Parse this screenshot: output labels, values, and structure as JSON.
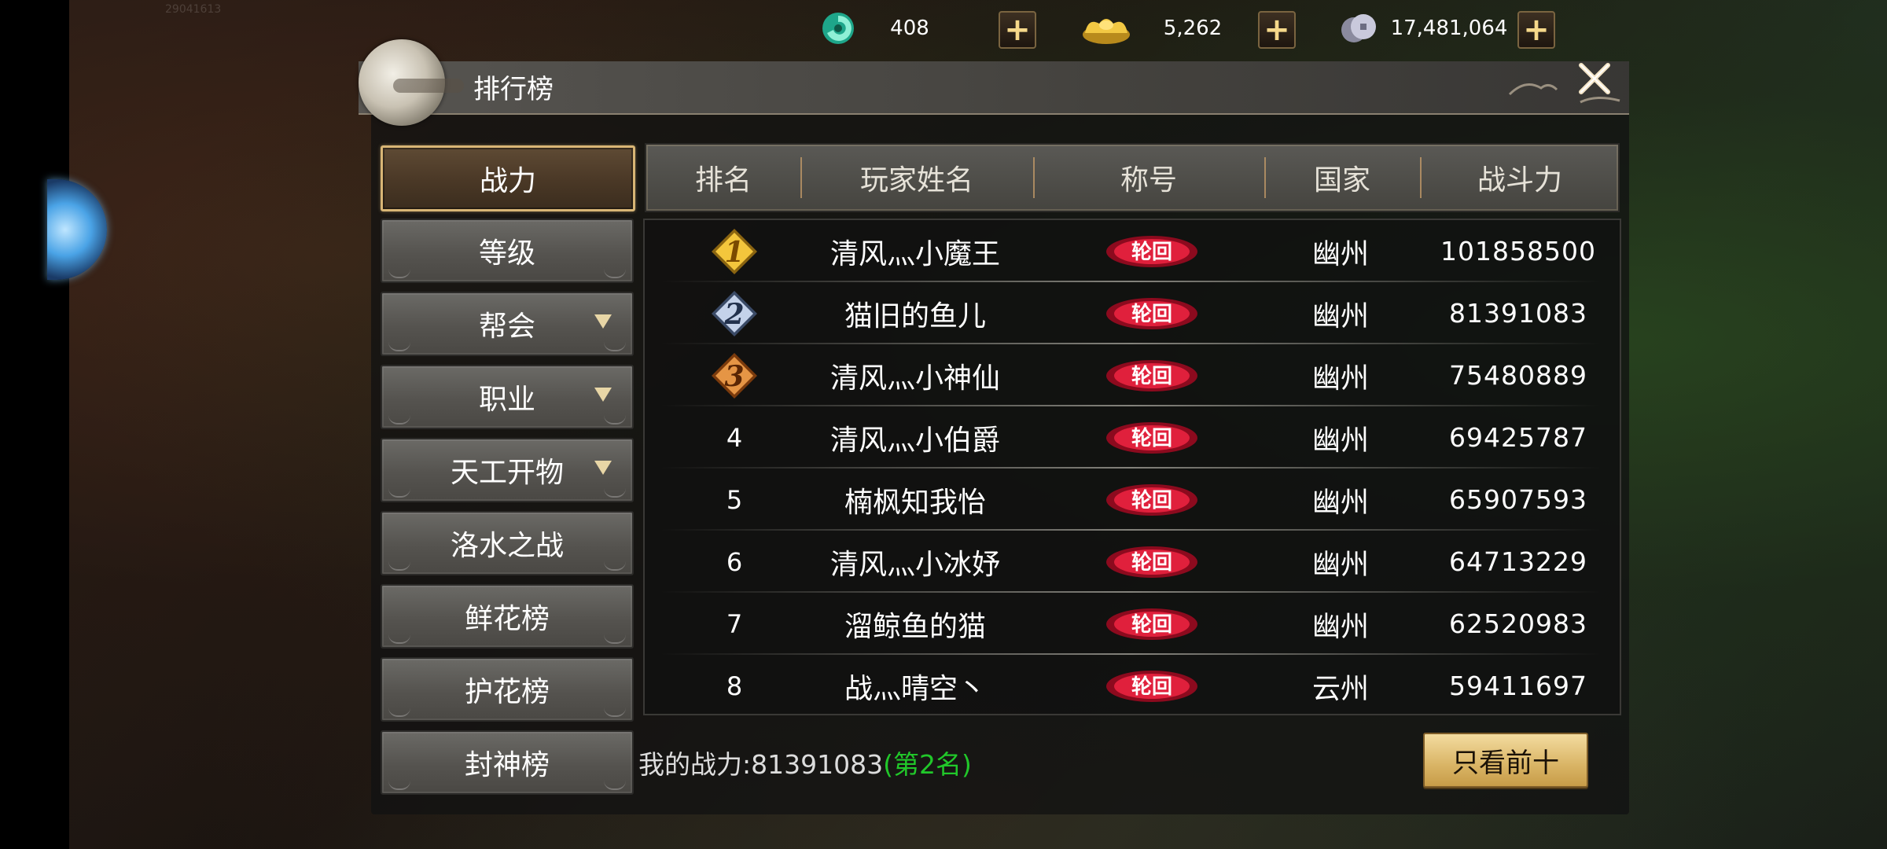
{
  "currencies": [
    {
      "icon": "jade-icon",
      "value": "408"
    },
    {
      "icon": "gold-ingot-icon",
      "value": "5,262"
    },
    {
      "icon": "silver-coin-icon",
      "value": "17,481,064"
    }
  ],
  "watermark_id": "29041613",
  "panel": {
    "title": "排行榜",
    "close_icon": "close-icon"
  },
  "categories": [
    {
      "label": "战力",
      "active": true,
      "has_arrow": false
    },
    {
      "label": "等级",
      "active": false,
      "has_arrow": false
    },
    {
      "label": "帮会",
      "active": false,
      "has_arrow": true
    },
    {
      "label": "职业",
      "active": false,
      "has_arrow": true
    },
    {
      "label": "天工开物",
      "active": false,
      "has_arrow": true
    },
    {
      "label": "洛水之战",
      "active": false,
      "has_arrow": false
    },
    {
      "label": "鲜花榜",
      "active": false,
      "has_arrow": false
    },
    {
      "label": "护花榜",
      "active": false,
      "has_arrow": false
    },
    {
      "label": "封神榜",
      "active": false,
      "has_arrow": false
    }
  ],
  "table": {
    "headers": [
      "排名",
      "玩家姓名",
      "称号",
      "国家",
      "战斗力"
    ],
    "rows": [
      {
        "rank": "1",
        "name": "清风灬小魔王",
        "title": "轮回",
        "country": "幽州",
        "power": "101858500"
      },
      {
        "rank": "2",
        "name": "猫旧的鱼儿",
        "title": "轮回",
        "country": "幽州",
        "power": "81391083"
      },
      {
        "rank": "3",
        "name": "清风灬小神仙",
        "title": "轮回",
        "country": "幽州",
        "power": "75480889"
      },
      {
        "rank": "4",
        "name": "清风灬小伯爵",
        "title": "轮回",
        "country": "幽州",
        "power": "69425787"
      },
      {
        "rank": "5",
        "name": "楠枫知我怡",
        "title": "轮回",
        "country": "幽州",
        "power": "65907593"
      },
      {
        "rank": "6",
        "name": "清风灬小冰妤",
        "title": "轮回",
        "country": "幽州",
        "power": "64713229"
      },
      {
        "rank": "7",
        "name": "溜鲸鱼的猫",
        "title": "轮回",
        "country": "幽州",
        "power": "62520983"
      },
      {
        "rank": "8",
        "name": "战灬晴空丶",
        "title": "轮回",
        "country": "云州",
        "power": "59411697"
      }
    ]
  },
  "footer": {
    "my_power_label": "我的战力:81391083",
    "my_rank": "(第2名)",
    "top10_button": "只看前十"
  },
  "colors": {
    "accent_gold": "#d9b465",
    "rank_green": "#21c82a",
    "badge_red": "#c8102e"
  }
}
